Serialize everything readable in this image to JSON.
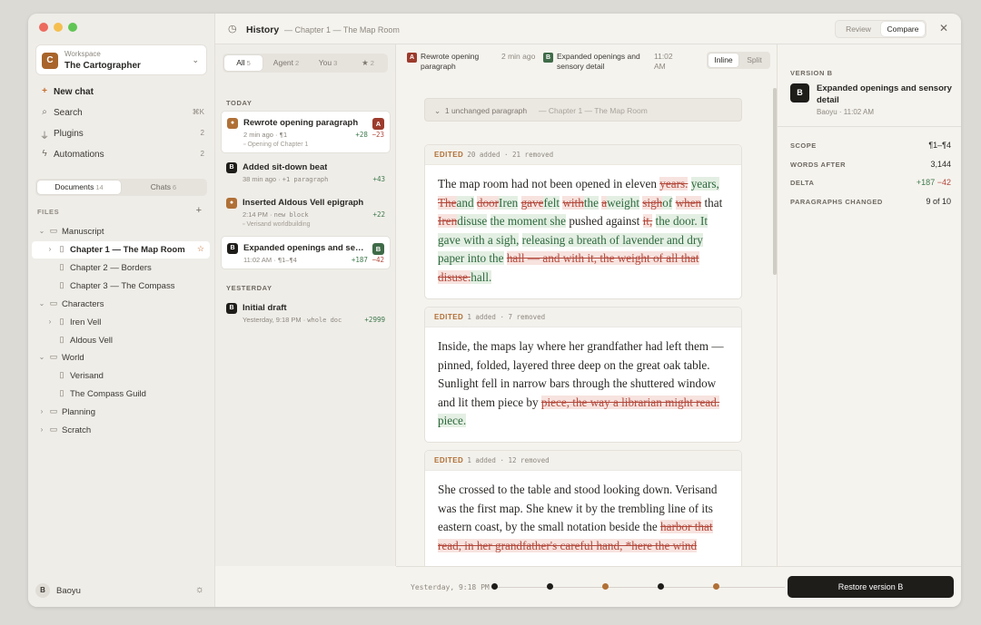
{
  "workspace": {
    "label": "Workspace",
    "name": "The Cartographer",
    "avatar": "C"
  },
  "nav": {
    "new_chat": "New chat",
    "search": "Search",
    "search_shortcut": "⌘K",
    "plugins": "Plugins",
    "plugins_count": "2",
    "automations": "Automations",
    "automations_count": "2"
  },
  "sidebar_tabs": {
    "documents": "Documents",
    "documents_count": "14",
    "chats": "Chats",
    "chats_count": "6"
  },
  "files": {
    "header": "FILES",
    "tree": [
      {
        "label": "Manuscript"
      },
      {
        "label": "Chapter 1 — The Map Room"
      },
      {
        "label": "Chapter 2 — Borders"
      },
      {
        "label": "Chapter 3 — The Compass"
      },
      {
        "label": "Characters"
      },
      {
        "label": "Iren Vell"
      },
      {
        "label": "Aldous Vell"
      },
      {
        "label": "World"
      },
      {
        "label": "Verisand"
      },
      {
        "label": "The Compass Guild"
      },
      {
        "label": "Planning"
      },
      {
        "label": "Scratch"
      }
    ]
  },
  "user": {
    "name": "Baoyu",
    "avatar": "B"
  },
  "topbar": {
    "title": "History",
    "subtitle": "— Chapter 1 — The Map Room",
    "review": "Review",
    "compare": "Compare"
  },
  "history": {
    "filters": [
      {
        "label": "All",
        "count": "5"
      },
      {
        "label": "Agent",
        "count": "2"
      },
      {
        "label": "You",
        "count": "3"
      },
      {
        "label": "★",
        "count": "2"
      }
    ],
    "today": "TODAY",
    "yesterday": "YESTERDAY",
    "items": [
      {
        "title": "Rewrote opening paragraph",
        "time": "2 min ago",
        "scope": "¶1",
        "tag": "Opening of Chapter 1",
        "added": "+28",
        "removed": "−23",
        "badge": "A",
        "icon": "●"
      },
      {
        "title": "Added sit-down beat",
        "time": "38 min ago",
        "scope": "+1 paragraph",
        "added": "+43",
        "icon": "B"
      },
      {
        "title": "Inserted Aldous Vell epigraph",
        "time": "2:14 PM",
        "scope": "new block",
        "tag": "Verisand worldbuilding",
        "added": "+22",
        "icon": "●"
      },
      {
        "title": "Expanded openings and sensory detail",
        "time": "11:02 AM",
        "scope": "¶1–¶4",
        "added": "+187",
        "removed": "−42",
        "badge": "B",
        "icon": "B"
      },
      {
        "title": "Initial draft",
        "time": "Yesterday, 9:18 PM",
        "scope": "whole doc",
        "added": "+2999",
        "icon": "B"
      }
    ]
  },
  "compare": {
    "a_badge": "A",
    "a_title": "Rewrote opening paragraph",
    "a_time": "2 min ago",
    "b_badge": "B",
    "b_title": "Expanded openings and sensory detail",
    "b_time": "11:02 AM",
    "inline": "Inline",
    "split": "Split"
  },
  "document": {
    "collapsed_label": "1 unchanged paragraph",
    "collapsed_sub": "— Chapter 1 — The Map Room",
    "edited_label": "EDITED",
    "p1_stats": "20 added · 21 removed",
    "p2_stats": "1 added · 7 removed",
    "p3_stats": "1 added · 12 removed",
    "p1": {
      "t1": "The map room had not been opened in eleven ",
      "d1": "years.",
      "i1": "years,",
      "d2": "The",
      "i2": "and",
      "d3": "door",
      "i3": "Iren",
      "d4": "gave",
      "i4": "felt",
      "d5": "with",
      "i5": "the",
      "d6": "a",
      "i6": "weight",
      "d7": "sigh",
      "i7": "of",
      "d8": "when",
      "t2": "that",
      "d9": "Iren",
      "i9": "disuse",
      "i10": "the moment she",
      "t3": "pushed against ",
      "d11": "it,",
      "i11": "the door. It gave with a sigh,",
      "i12": "releasing a breath of lavender and dry paper into the",
      "d13": "hall — and with it, the weight of all that disuse.",
      "i13": "hall."
    },
    "p2": {
      "t1": "Inside, the maps lay where her grandfather had left them — pinned, folded, layered three deep on the great oak table. Sunlight fell in narrow bars through the shuttered window and lit them piece by ",
      "d1": "piece, the way a librarian might read.",
      "i1": "piece."
    },
    "p3": {
      "t1": "She crossed to the table and stood looking down. Verisand was the first map. She knew it by the trembling line of its eastern coast, by the small notation beside the ",
      "d1": "harbor that read, in her grandfather's careful hand, *here the wind"
    }
  },
  "version_panel": {
    "label": "VERSION B",
    "avatar": "B",
    "title": "Expanded openings and sensory detail",
    "sub": "Baoyu · 11:02 AM",
    "rows": [
      {
        "k": "SCOPE",
        "v": "¶1–¶4"
      },
      {
        "k": "WORDS AFTER",
        "v": "3,144"
      },
      {
        "k": "DELTA",
        "v_add": "+187",
        "v_rem": "−42"
      },
      {
        "k": "PARAGRAPHS CHANGED",
        "v": "9 of 10"
      }
    ]
  },
  "timeline": {
    "time": "Yesterday, 9:18 PM",
    "restore": "Restore version B"
  }
}
